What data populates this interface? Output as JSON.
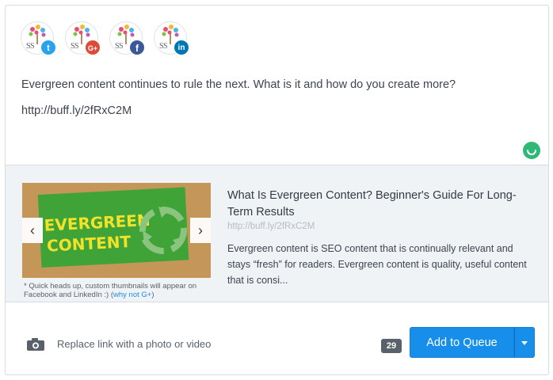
{
  "profiles": [
    {
      "name": "SS",
      "network": "twitter",
      "icon": "twitter-icon",
      "badge": "t"
    },
    {
      "name": "SS",
      "network": "google-plus",
      "icon": "google-plus-icon",
      "badge": "G+"
    },
    {
      "name": "SS",
      "network": "facebook",
      "icon": "facebook-icon",
      "badge": "f"
    },
    {
      "name": "SS",
      "network": "linkedin",
      "icon": "linkedin-icon",
      "badge": "in"
    }
  ],
  "post": {
    "text": "Evergreen content continues to rule the next. What is it and how do you create more?",
    "link": "http://buff.ly/2fRxC2M"
  },
  "attachment": {
    "title": "What Is Evergreen Content? Beginner's Guide For Long-Term Results",
    "url": "http://buff.ly/2fRxC2M",
    "description": "Evergreen content is SEO content that is continually relevant and stays “fresh” for readers. Evergreen content is quality, useful content that is consi...",
    "thumbnail_text_line1": "EVERGREEN",
    "thumbnail_text_line2": "CONTENT",
    "note": "* Quick heads up, custom thumbnails will appear on Facebook and LinkedIn :) (",
    "note_link": "why not G+",
    "note_end": ")",
    "prev_arrow": "‹",
    "next_arrow": "›"
  },
  "footer": {
    "media_label": "Replace link with a photo or video",
    "char_count": "29",
    "queue_label": "Add to Queue"
  },
  "colors": {
    "accent": "#168eea",
    "twitter": "#2aa3ef",
    "google_plus": "#dd4b39",
    "facebook": "#3b5998",
    "linkedin": "#0077b5",
    "status_ok": "#2fb876"
  }
}
